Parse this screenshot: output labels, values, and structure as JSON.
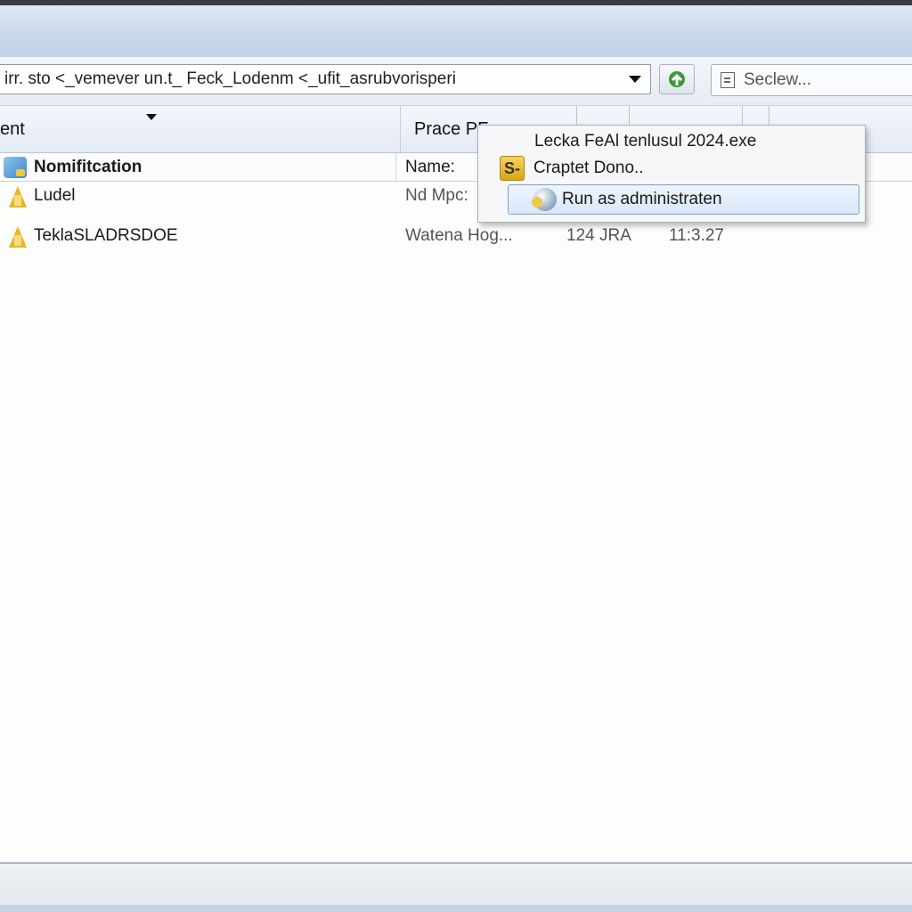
{
  "address_bar": {
    "path_text": "irr. sto  <_vemever un.t_ Feck_Lodenm  <_ufit_asrubvorisperi"
  },
  "search": {
    "placeholder": "Seclew..."
  },
  "columns": {
    "col1": "ent",
    "col2": "Prace PF",
    "col3": "",
    "col4": "",
    "col5": ""
  },
  "group_header": {
    "name": "Nomifitcation",
    "col2": "Name:"
  },
  "rows": [
    {
      "name": "Ludel",
      "col2": "Nd Mpc:",
      "col3": "",
      "col4": ""
    },
    {
      "name": "TeklaSLADRSDOE",
      "col2": "Watena Hog...",
      "col3": "124 JRA",
      "col4": "11:3.27"
    }
  ],
  "context_menu": {
    "item_filename": "Lecka FeAl tenlusul 2024.exe",
    "item_open": "Craptet Dono..",
    "app_icon_letter": "S-",
    "item_run_admin": "Run as administraten"
  },
  "icons": {
    "go": "go-arrow-icon",
    "search": "search-icon",
    "folder": "folder-icon",
    "network": "network-icon",
    "app": "app-icon",
    "shield": "shield-icon"
  },
  "colors": {
    "title_band": "#c9d9ec",
    "highlight_border": "#7da2ce",
    "folder_yellow": "#e5b52a"
  }
}
